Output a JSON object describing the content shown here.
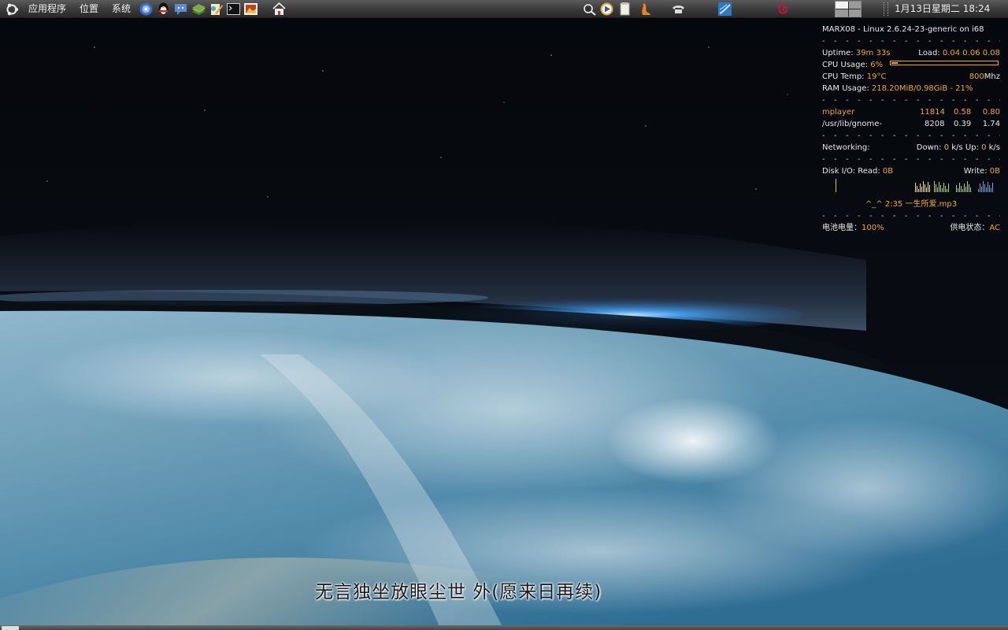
{
  "top_panel": {
    "menus": [
      "应用程序",
      "位置",
      "系统"
    ],
    "clock": "1月13日星期二 18:24",
    "launchers": [
      "firefox-icon",
      "qq-icon",
      "pidgin-icon",
      "stardict-icon",
      "text-editor-icon",
      "terminal-icon",
      "image-viewer-icon",
      "home-folder-icon"
    ],
    "tray": [
      "scim-input-icon",
      "media-player-icon",
      "notes-icon",
      "gnome-foot-icon",
      "phone-icon",
      "network-icon",
      "debian-swirl-icon"
    ]
  },
  "conky": {
    "system_line": "MARX08 - Linux 2.6.24-23-generic on i68",
    "uptime_label": "Uptime:",
    "uptime_value": "39m 33s",
    "load_label": "Load:",
    "load_values": "0.04 0.06 0.08",
    "cpu_usage_label": "CPU Usage:",
    "cpu_usage_value": "6%",
    "cpu_usage_fraction": 0.06,
    "cpu_temp_label": "CPU Temp:",
    "cpu_temp_value": "19°C",
    "cpu_freq_value": "800",
    "cpu_freq_unit": "Mhz",
    "ram_label": "RAM Usage:",
    "ram_value": "218.20MiB/0.98GiB - 21%",
    "processes": [
      {
        "name": "mplayer",
        "pid": "11814",
        "cpu": "0.58",
        "mem": "0.80"
      },
      {
        "name": "/usr/lib/gnome-",
        "pid": "8208",
        "cpu": "0.39",
        "mem": "1.74"
      }
    ],
    "networking_label": "Networking:",
    "down_label": "Down:",
    "down_value": "0",
    "down_unit": "k/s",
    "up_label": "Up:",
    "up_value": "0",
    "up_unit": "k/s",
    "disk_label": "Disk I/O: Read:",
    "disk_read_value": "0B",
    "disk_write_label": "Write:",
    "disk_write_value": "0B",
    "now_playing": "^_^ 2:35 一生所爱.mp3",
    "battery_label": "电池电量：",
    "battery_value": "100%",
    "power_label": "供电状态：",
    "power_value": "AC"
  },
  "lyric": "无言独坐放眼尘世 外(愿来日再续)",
  "colors": {
    "conky_accent": "#f0a830",
    "conky_text": "#e8e8e8",
    "panel": "#3a3a3a"
  }
}
